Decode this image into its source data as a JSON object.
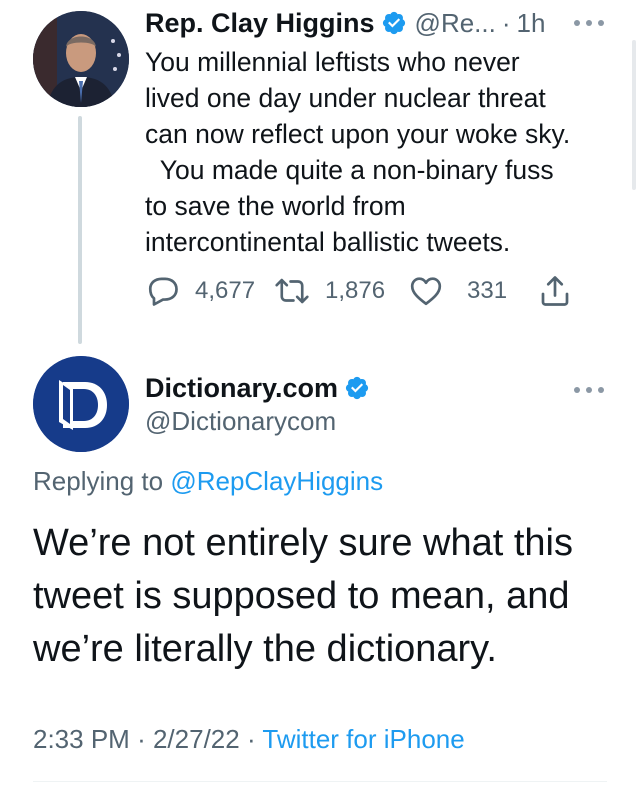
{
  "parent_tweet": {
    "author_name": "Rep. Clay Higgins",
    "handle": "@Re...",
    "separator": "·",
    "time_ago": "1h",
    "text": "You millennial leftists who never\nlived one day under nuclear threat\ncan now reflect upon your woke sky.\n  You made quite a non-binary fuss\nto save the world from\nintercontinental ballistic tweets.",
    "replies_count": "4,677",
    "retweets_count": "1,876",
    "likes_count": "331"
  },
  "reply_tweet": {
    "author_name": "Dictionary.com",
    "handle": "@Dictionarycom",
    "replying_to_prefix": "Replying to",
    "replying_to_mention": "@RepClayHiggins",
    "text": "We’re not entirely sure what this tweet is supposed to mean, and we’re literally the dictionary.",
    "time": "2:33 PM",
    "separator1": "·",
    "date": "2/27/22",
    "separator2": "·",
    "client": "Twitter for iPhone"
  },
  "colors": {
    "text_primary": "#0f1419",
    "text_secondary": "#536471",
    "accent": "#1d9bf0",
    "thread_line": "#cfd9de",
    "dictionary_logo_bg": "#163b8a"
  },
  "icons": {
    "verified": "verified-badge-icon",
    "more": "more-dots-icon",
    "reply": "reply-bubble-icon",
    "retweet": "retweet-icon",
    "like": "heart-icon",
    "share": "share-icon"
  }
}
